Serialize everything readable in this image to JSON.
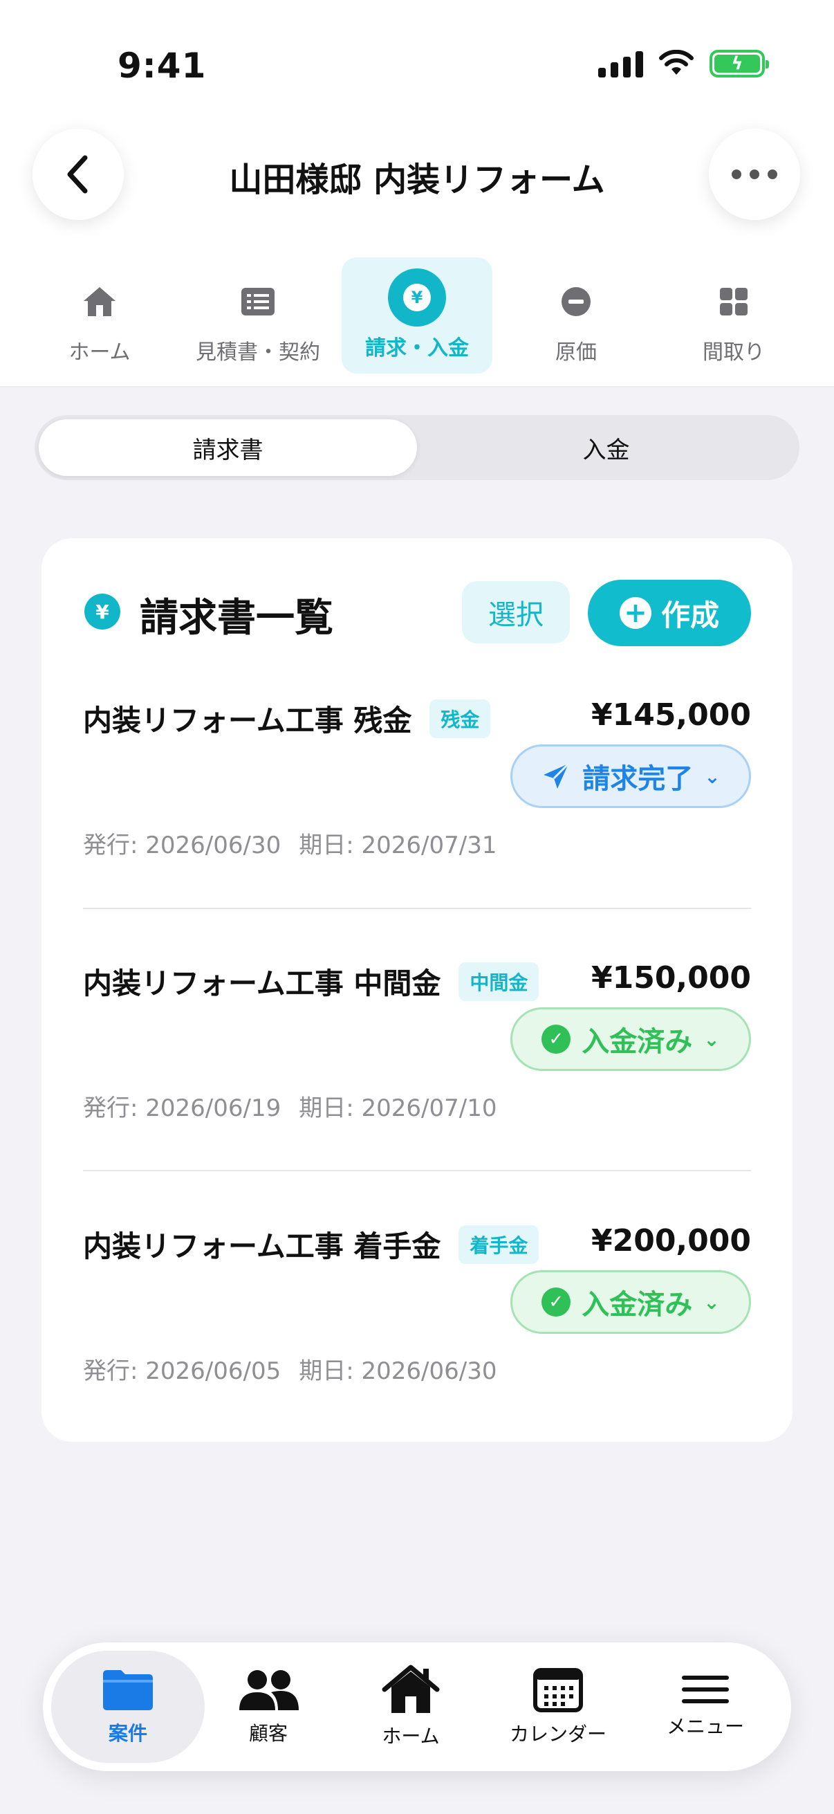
{
  "status_bar": {
    "time": "9:41"
  },
  "header": {
    "title": "山田様邸 内装リフォーム"
  },
  "tabs": [
    {
      "label": "ホーム",
      "icon": "house-icon",
      "active": false
    },
    {
      "label": "見積書・契約",
      "icon": "document-list-icon",
      "active": false
    },
    {
      "label": "請求・入金",
      "icon": "yen-icon",
      "active": true
    },
    {
      "label": "原価",
      "icon": "minus-circle-icon",
      "active": false
    },
    {
      "label": "間取り",
      "icon": "grid-icon",
      "active": false
    }
  ],
  "segmented": {
    "left": "請求書",
    "right": "入金",
    "selected": "請求書"
  },
  "card": {
    "title": "請求書一覧",
    "select_label": "選択",
    "create_label": "作成"
  },
  "invoices": [
    {
      "title": "内装リフォーム工事 残金",
      "tag": "残金",
      "amount": "¥145,000",
      "status": "請求完了",
      "status_type": "sent",
      "issued": "発行: 2026/06/30",
      "due": "期日: 2026/07/31"
    },
    {
      "title": "内装リフォーム工事 中間金",
      "tag": "中間金",
      "amount": "¥150,000",
      "status": "入金済み",
      "status_type": "paid",
      "issued": "発行: 2026/06/19",
      "due": "期日: 2026/07/10"
    },
    {
      "title": "内装リフォーム工事 着手金",
      "tag": "着手金",
      "amount": "¥200,000",
      "status": "入金済み",
      "status_type": "paid",
      "issued": "発行: 2026/06/05",
      "due": "期日: 2026/06/30"
    }
  ],
  "bottom_nav": [
    {
      "label": "案件",
      "icon": "folder-icon",
      "active": true
    },
    {
      "label": "顧客",
      "icon": "people-icon",
      "active": false
    },
    {
      "label": "ホーム",
      "icon": "house-icon",
      "active": false
    },
    {
      "label": "カレンダー",
      "icon": "calendar-icon",
      "active": false
    },
    {
      "label": "メニュー",
      "icon": "menu-icon",
      "active": false
    }
  ],
  "colors": {
    "accent": "#11b7c8",
    "sent": "#1f84e6",
    "paid": "#2fc057",
    "active_nav": "#1a7ae6"
  }
}
